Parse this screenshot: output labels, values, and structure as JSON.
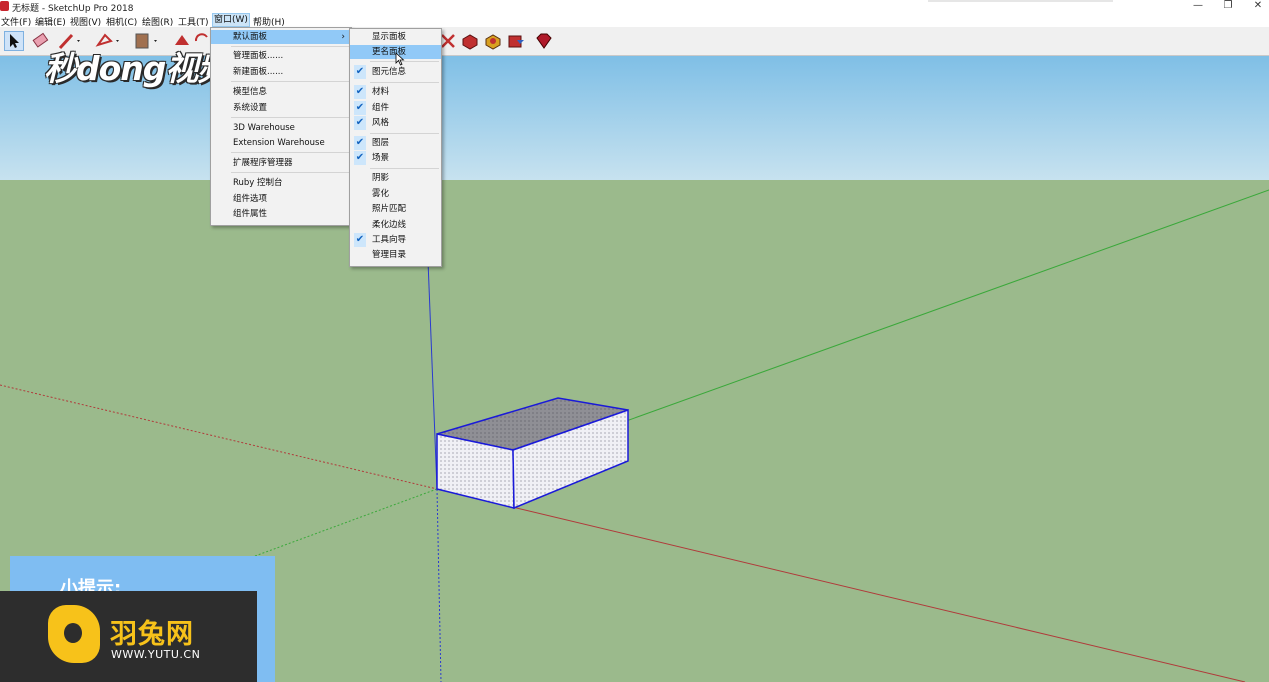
{
  "window": {
    "title": "无标题 - SketchUp Pro 2018",
    "minimize_icon": "minimize-icon",
    "restore_icon": "restore-icon",
    "close_icon": "close-icon"
  },
  "menubar": {
    "items": [
      "文件(F)",
      "编辑(E)",
      "视图(V)",
      "相机(C)",
      "绘图(R)",
      "工具(T)",
      "窗口(W)",
      "帮助(H)"
    ],
    "active": "窗口(W)"
  },
  "toolbar": {
    "tools": [
      "select-icon",
      "eraser-icon",
      "pencil-icon",
      "shapes-icon",
      "paint-bucket-icon",
      "push-pull-icon",
      "rotate-icon",
      "orbit-icon",
      "components-icon",
      "warehouse-icon",
      "share-icon",
      "ruby-icon"
    ]
  },
  "watermark": {
    "text": "秒dong视频"
  },
  "window_menu": {
    "items": [
      {
        "label": "默认面板",
        "has_submenu": true,
        "highlighted": true
      },
      {
        "label": "管理面板......"
      },
      {
        "label": "新建面板......"
      },
      {
        "label": "模型信息"
      },
      {
        "label": "系统设置"
      },
      {
        "label": "3D Warehouse"
      },
      {
        "label": "Extension Warehouse"
      },
      {
        "label": "扩展程序管理器"
      },
      {
        "label": "Ruby 控制台"
      },
      {
        "label": "组件选项"
      },
      {
        "label": "组件属性"
      }
    ]
  },
  "panels_submenu": {
    "items": [
      {
        "label": "显示面板",
        "checked": false
      },
      {
        "label": "更名面板",
        "checked": false,
        "highlighted": true
      },
      {
        "label": "图元信息",
        "checked": true
      },
      {
        "label": "材料",
        "checked": true
      },
      {
        "label": "组件",
        "checked": true
      },
      {
        "label": "风格",
        "checked": true
      },
      {
        "label": "图层",
        "checked": true
      },
      {
        "label": "场景",
        "checked": true
      },
      {
        "label": "阴影",
        "checked": false
      },
      {
        "label": "雾化",
        "checked": false
      },
      {
        "label": "照片匹配",
        "checked": false
      },
      {
        "label": "柔化边线",
        "checked": false
      },
      {
        "label": "工具向导",
        "checked": true
      },
      {
        "label": "管理目录",
        "checked": false
      }
    ]
  },
  "tip": {
    "title": "小提示:"
  },
  "logo": {
    "name": "羽兔网",
    "url": "WWW.YUTU.CN"
  },
  "colors": {
    "axis_red": "#b03a3a",
    "axis_green": "#3aa83a",
    "axis_blue": "#2a3ad0",
    "box_edge": "#1a1ad8",
    "sky": "#8cc6e8",
    "ground": "#9bba8c"
  }
}
